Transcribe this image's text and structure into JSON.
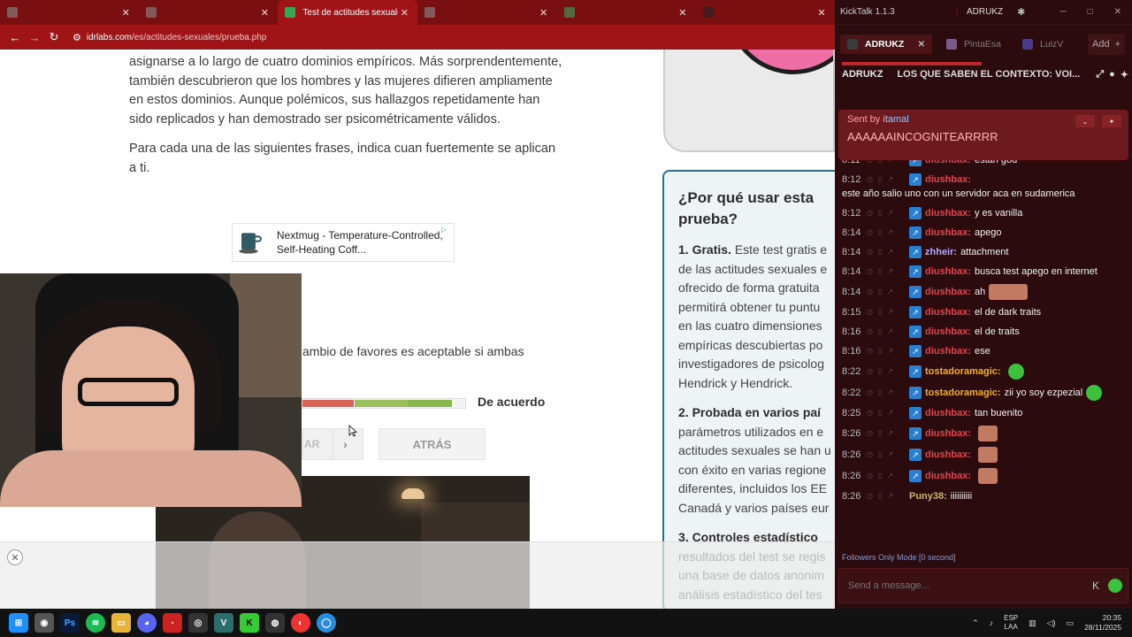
{
  "browser": {
    "tabs": [
      {
        "label": "",
        "favicon_color": "#8a8a8a",
        "active": false
      },
      {
        "label": "",
        "favicon_color": "#8a8a8a",
        "active": false
      },
      {
        "label": "Test de actitudes sexuales",
        "favicon_color": "#34a853",
        "active": true
      },
      {
        "label": "",
        "favicon_color": "#8a8a8a",
        "active": false
      },
      {
        "label": "",
        "favicon_color": "#34a853",
        "active": false
      },
      {
        "label": "",
        "favicon_color": "#222222",
        "active": false
      }
    ],
    "url_host": "idrlabs.com",
    "url_path": "/es/actitudes-sexuales/prueba.php"
  },
  "page": {
    "intro_paragraph": "asignarse a lo largo de cuatro dominios empíricos. Más sorprendentemente, también descubrieron que los hombres y las mujeres difieren ampliamente en estos dominios. Aunque polémicos, sus hallazgos repetidamente han sido replicados y han demostrado ser psicométricamente válidos.",
    "instruction": "Para cada una de las siguientes frases, indica cuan fuertemente se aplican a ti.",
    "ad_text": "Nextmug - Temperature-Controlled, Self-Heating Coff...",
    "question_text": "ambio de favores es aceptable si ambas",
    "agree_label": "De acuerdo",
    "next_label": "AR",
    "back_label": "ATRÁS",
    "sidebar": {
      "title": "¿Por qué usar esta prueba?",
      "item1_head": "1. Gratis.",
      "item1_lines": [
        "Este test gratis e",
        "de las actitudes sexuales e",
        "ofrecido de forma gratuita",
        "permitirá obtener tu puntu",
        "en las cuatro dimensiones",
        "empíricas descubiertas po",
        "investigadores de psicolog",
        "Hendrick y Hendrick."
      ],
      "item2_head": "2. Probada en varios paí",
      "item2_lines": [
        "parámetros utilizados en e",
        "actitudes sexuales se han u",
        "con éxito en varias regione",
        "diferentes, incluidos los EE",
        "Canadá y varios países eur"
      ],
      "item3_head": "3. Controles estadístico",
      "item3_lines": [
        "resultados del test se regis",
        "una base de datos anonim",
        "análisis estadístico del tes"
      ]
    }
  },
  "kicktalk": {
    "app_name": "KickTalk 1.1.3",
    "user": "ADRUKZ",
    "tabs": [
      {
        "label": "ADRUKZ",
        "active": true,
        "icon_color": "#3a3a3a"
      },
      {
        "label": "PintaEsa",
        "active": false,
        "icon_color": "#7a5a8a"
      },
      {
        "label": "LuizV",
        "active": false,
        "icon_color": "#4a3a8a"
      }
    ],
    "add_label": "Add",
    "channel_name": "ADRUKZ",
    "stream_title": "LOS QUE SABEN EL CONTEXTO: VOI...",
    "pinned": {
      "sent_by": "Sent by",
      "sender": "itamal",
      "text": "AAAAAAINCOGNITEARRRR"
    },
    "messages": [
      {
        "time": "8:11",
        "user": "diushbax:",
        "color": "#e0454f",
        "text": "estan god"
      },
      {
        "time": "8:12",
        "user": "diushbax:",
        "color": "#e0454f",
        "text": "este año salio uno con un servidor aca en sudamerica"
      },
      {
        "time": "8:12",
        "user": "diushbax:",
        "color": "#e0454f",
        "text": "y es vanilla"
      },
      {
        "time": "8:14",
        "user": "diushbax:",
        "color": "#e0454f",
        "text": "apego"
      },
      {
        "time": "8:14",
        "user": "zhheir:",
        "color": "#b6a8ff",
        "text": "attachment"
      },
      {
        "time": "8:14",
        "user": "diushbax:",
        "color": "#e0454f",
        "text": "busca test apego en internet"
      },
      {
        "time": "8:14",
        "user": "diushbax:",
        "color": "#e0454f",
        "text": "ah",
        "emote": "wide"
      },
      {
        "time": "8:15",
        "user": "diushbax:",
        "color": "#e0454f",
        "text": "el de dark traits"
      },
      {
        "time": "8:16",
        "user": "diushbax:",
        "color": "#e0454f",
        "text": "el de traits"
      },
      {
        "time": "8:16",
        "user": "diushbax:",
        "color": "#e0454f",
        "text": "ese"
      },
      {
        "time": "8:22",
        "user": "tostadoramagic:",
        "color": "#f2b11a",
        "text": "",
        "emote": "green"
      },
      {
        "time": "8:22",
        "user": "tostadoramagic:",
        "color": "#f2b11a",
        "text": "zii yo soy ezpezial",
        "emote": "green"
      },
      {
        "time": "8:25",
        "user": "diushbax:",
        "color": "#e0454f",
        "text": "tan buenito"
      },
      {
        "time": "8:26",
        "user": "diushbax:",
        "color": "#e0454f",
        "text": "",
        "emote": "face"
      },
      {
        "time": "8:26",
        "user": "diushbax:",
        "color": "#e0454f",
        "text": "",
        "emote": "face"
      },
      {
        "time": "8:26",
        "user": "diushbax:",
        "color": "#e0454f",
        "text": "",
        "emote": "face"
      },
      {
        "time": "8:26",
        "user": "Puny38:",
        "color": "#c8b86a",
        "text": "iiiiiiiiii",
        "nobadge": true
      }
    ],
    "mode_text": "Followers Only Mode [0 second]",
    "input_placeholder": "Send a message..."
  },
  "taskbar": {
    "lang_top": "ESP",
    "lang_bottom": "LAA",
    "time": "20:35",
    "date": "28/11/2025"
  }
}
